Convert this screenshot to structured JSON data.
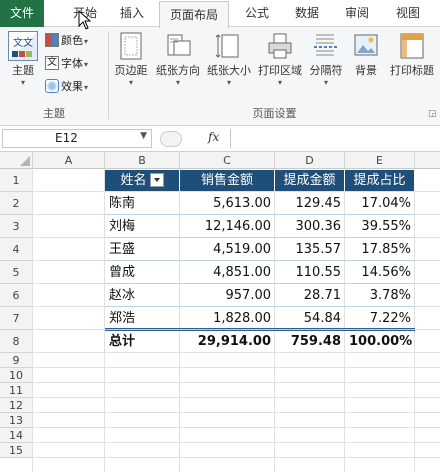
{
  "tabs": [
    "文件",
    "开始",
    "插入",
    "页面布局",
    "公式",
    "数据",
    "审阅",
    "视图"
  ],
  "ribbon": {
    "theme_group": {
      "label": "主题",
      "themes_button": "主题",
      "colors": "颜色",
      "fonts": "字体",
      "effects": "效果"
    },
    "page_setup_group": {
      "label": "页面设置",
      "buttons": [
        "页边距",
        "纸张方向",
        "纸张大小",
        "打印区域",
        "分隔符",
        "背景",
        "打印标题"
      ]
    }
  },
  "formula_bar": {
    "name_box": "E12",
    "fx": "fx",
    "formula": ""
  },
  "columns": [
    "A",
    "B",
    "C",
    "D",
    "E"
  ],
  "rows": [
    "1",
    "2",
    "3",
    "4",
    "5",
    "6",
    "7",
    "8",
    "9",
    "10",
    "11",
    "12",
    "13",
    "14",
    "15"
  ],
  "table": {
    "headers": [
      "姓名",
      "销售金额",
      "提成金额",
      "提成占比"
    ],
    "data": [
      [
        "陈南",
        "5,613.00",
        "129.45",
        "17.04%"
      ],
      [
        "刘梅",
        "12,146.00",
        "300.36",
        "39.55%"
      ],
      [
        "王盛",
        "4,519.00",
        "135.57",
        "17.85%"
      ],
      [
        "曾成",
        "4,851.00",
        "110.55",
        "14.56%"
      ],
      [
        "赵冰",
        "957.00",
        "28.71",
        "3.78%"
      ],
      [
        "郑浩",
        "1,828.00",
        "54.84",
        "7.22%"
      ]
    ],
    "total": [
      "总计",
      "29,914.00",
      "759.48",
      "100.00%"
    ]
  },
  "colors": {
    "file_tab": "#217346",
    "header_fill": "#1f4e79"
  }
}
